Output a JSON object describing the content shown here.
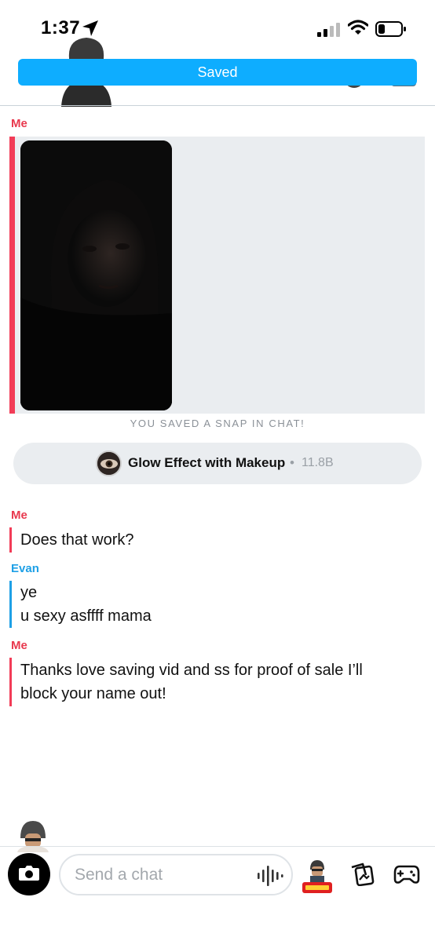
{
  "status_bar": {
    "time": "1:37"
  },
  "banner": {
    "label": "Saved"
  },
  "messages": [
    {
      "sender": "Me",
      "type": "snap"
    },
    {
      "sender": "Me",
      "lines": [
        "Does that work?"
      ]
    },
    {
      "sender": "Evan",
      "lines": [
        "ye",
        "u sexy asffff mama"
      ]
    },
    {
      "sender": "Me",
      "lines": [
        "Thanks love saving vid and ss for proof of sale I’ll",
        "block your name out!"
      ]
    }
  ],
  "snap_note": "YOU SAVED A SNAP IN CHAT!",
  "lens": {
    "name": "Glow Effect with Makeup",
    "separator": "•",
    "count": "11.8B"
  },
  "composer": {
    "placeholder": "Send a chat"
  },
  "colors": {
    "me": "#f23c57",
    "evan": "#1ea0e6",
    "banner": "#0eadff"
  },
  "icons": [
    "location-arrow-icon",
    "signal-icon",
    "wifi-icon",
    "battery-icon",
    "camera-icon",
    "microphone-icon",
    "memories-icon",
    "games-icon"
  ]
}
